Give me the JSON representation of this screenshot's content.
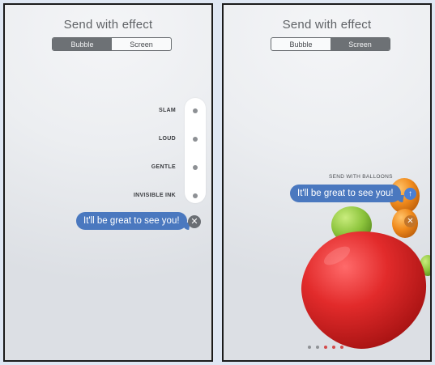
{
  "left": {
    "title": "Send with effect",
    "tabs": [
      {
        "label": "Bubble",
        "active": true
      },
      {
        "label": "Screen",
        "active": false
      }
    ],
    "effects": [
      {
        "label": "SLAM"
      },
      {
        "label": "LOUD"
      },
      {
        "label": "GENTLE"
      },
      {
        "label": "INVISIBLE INK"
      }
    ],
    "message": "It'll be great to see you!",
    "close_icon": "close-icon"
  },
  "right": {
    "title": "Send with effect",
    "tabs": [
      {
        "label": "Bubble",
        "active": false
      },
      {
        "label": "Screen",
        "active": true
      }
    ],
    "effect_label": "SEND WITH BALLOONS",
    "message": "It'll be great to see you!",
    "send_icon": "up-arrow-icon",
    "close_icon": "close-icon",
    "page_dots": 5,
    "active_dot_indices": [
      2,
      3,
      4
    ]
  },
  "colors": {
    "bubble": "#4a78bf",
    "active_tab": "#6d7175",
    "balloon_red": "#e22b2b",
    "balloon_orange": "#f08a1c",
    "balloon_green": "#8cc43c"
  }
}
